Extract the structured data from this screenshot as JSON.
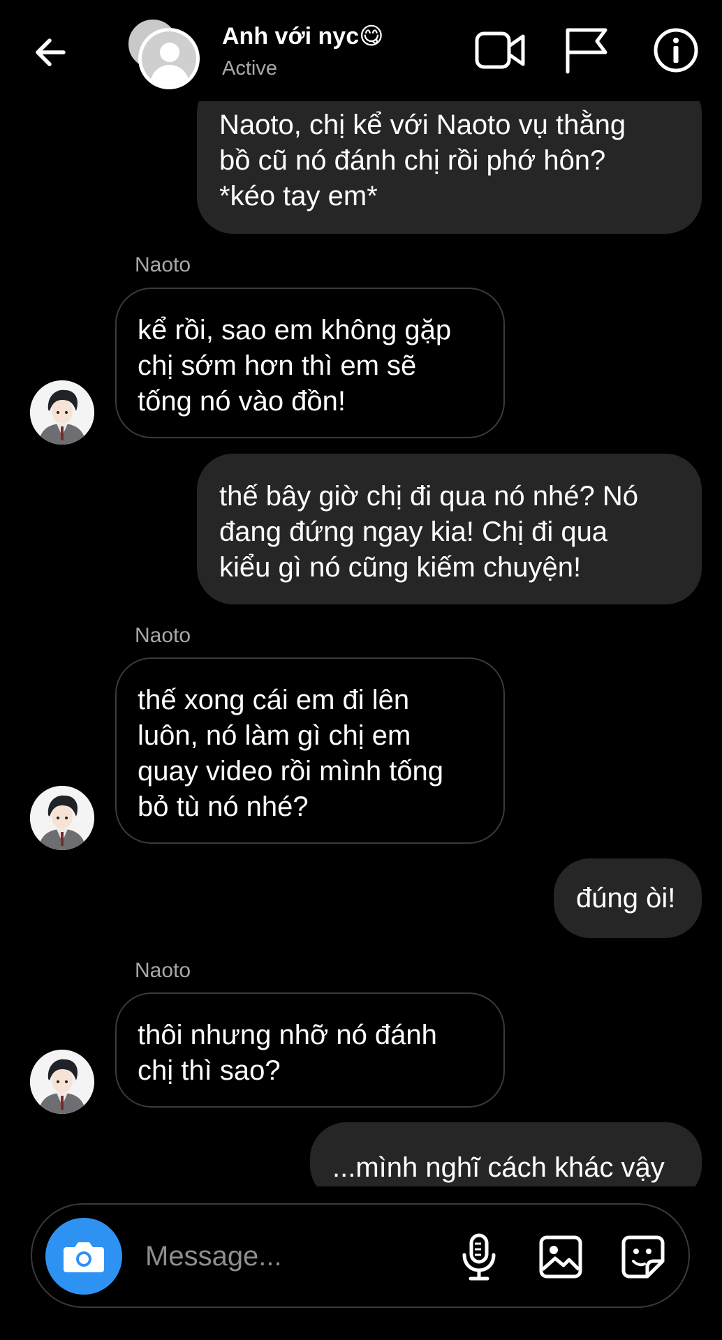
{
  "header": {
    "title": "Anh với nyc😋",
    "status": "Active"
  },
  "messages": [
    {
      "direction": "outgoing",
      "text": "Naoto, chị kể với Naoto vụ thằng\nbồ cũ nó đánh chị rồi phớ hôn?\n*kéo tay em*"
    },
    {
      "direction": "incoming",
      "sender": "Naoto",
      "text": "kể rồi, sao em không gặp\nchị sớm hơn thì em sẽ\ntống nó vào đồn!"
    },
    {
      "direction": "outgoing",
      "text": "thế bây giờ chị đi qua nó nhé? Nó\nđang đứng ngay kia! Chị đi qua\nkiểu gì nó cũng kiếm chuyện!"
    },
    {
      "direction": "incoming",
      "sender": "Naoto",
      "text": "thế xong cái em đi lên\nluôn, nó làm gì chị em\nquay video rồi mình tống\nbỏ tù nó nhé?"
    },
    {
      "direction": "outgoing",
      "text": "đúng òi!"
    },
    {
      "direction": "incoming",
      "sender": "Naoto",
      "text": "thôi nhưng nhỡ nó đánh\nchị thì sao?"
    },
    {
      "direction": "outgoing",
      "text": "...mình nghĩ cách khác vậy"
    }
  ],
  "composer": {
    "placeholder": "Message..."
  },
  "icons": {
    "back": "arrow-left-icon",
    "video_call": "video-camera-icon",
    "report": "flag-icon",
    "info": "info-icon",
    "camera": "camera-icon",
    "mic": "microphone-icon",
    "gallery": "image-icon",
    "sticker": "sticker-icon"
  },
  "colors": {
    "background": "#000000",
    "outgoing_bubble": "#262626",
    "incoming_border": "#3a3a3a",
    "camera_button": "#2e92f3",
    "secondary_text": "#a8a8a8"
  }
}
